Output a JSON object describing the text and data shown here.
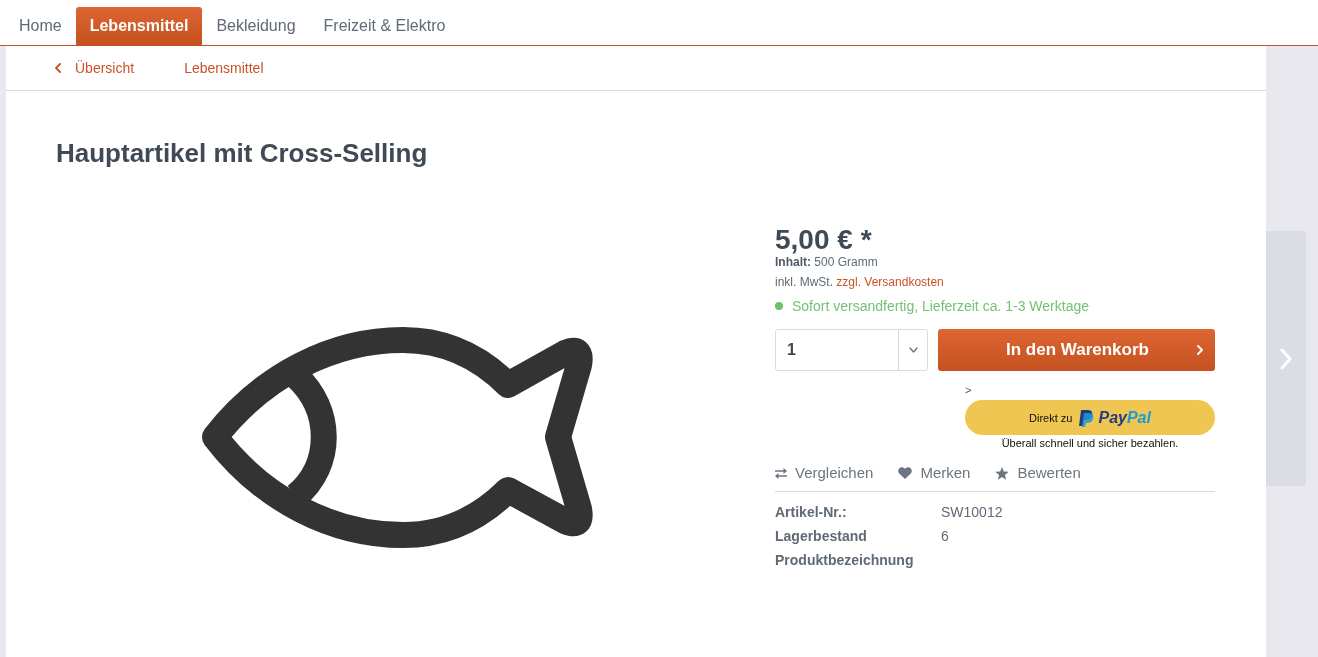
{
  "navigation": {
    "tabs": [
      {
        "label": "Home",
        "selected": false
      },
      {
        "label": "Lebensmittel",
        "selected": true
      },
      {
        "label": "Bekleidung",
        "selected": false
      },
      {
        "label": "Freizeit & Elektro",
        "selected": false
      }
    ]
  },
  "breadcrumb": {
    "back": "Übersicht",
    "items": [
      "Lebensmittel"
    ]
  },
  "product": {
    "title": "Hauptartikel mit Cross-Selling",
    "price": "5,00 € *",
    "content": "**Inhalt:** 500 Gramm",
    "tax_note": "inkl. MwSt.",
    "shipping_link": "zzgl. Versandkosten",
    "delivery": {
      "text": "Sofort versandfertig, Lieferzeit ca. 1-3 Werktage",
      "in_stock": true
    }
  },
  "buy": {
    "quantity": "1",
    "button": "In den Warenkorb"
  },
  "paypal": {
    "marker": ">",
    "prefix": "Direkt zu",
    "logo_dark": "Pay",
    "logo_light": "Pal",
    "note": "Überall schnell und sicher bezahlen."
  },
  "actions": [
    {
      "kind": "compare",
      "label": "Vergleichen"
    },
    {
      "kind": "wishlist",
      "label": "Merken"
    },
    {
      "kind": "rate",
      "label": "Bewerten"
    }
  ],
  "properties": [
    {
      "label": "Artikel-Nr.:",
      "value": "SW10012"
    },
    {
      "label": "Lagerbestand",
      "value": "6"
    },
    {
      "label": "Produktbezeichnung"
    }
  ]
}
